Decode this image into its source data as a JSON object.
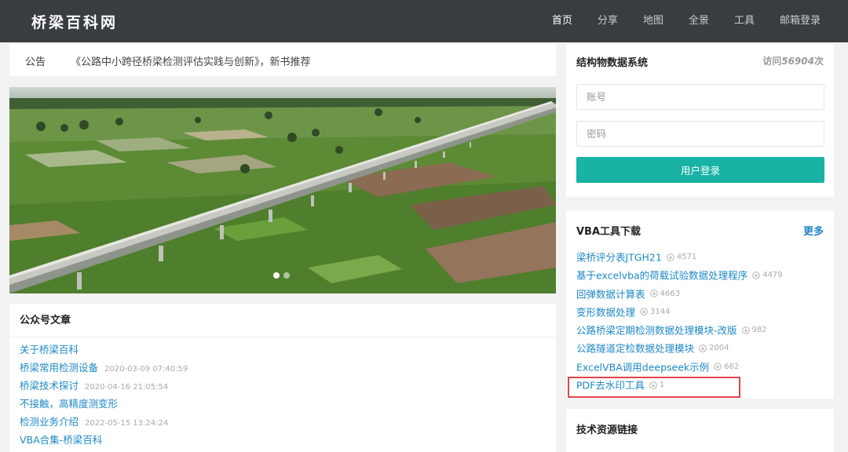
{
  "header": {
    "logo": "桥梁百科网",
    "nav": [
      "首页",
      "分享",
      "地图",
      "全景",
      "工具",
      "邮箱登录"
    ]
  },
  "notice": {
    "label": "公告",
    "text": "《公路中小跨径桥梁检测评估实践与创新》，新书推荐"
  },
  "articles": {
    "title": "公众号文章",
    "items": [
      {
        "title": "关于桥梁百科",
        "date": ""
      },
      {
        "title": "桥梁常用检测设备",
        "date": "2020-03-09 07:40:59"
      },
      {
        "title": "桥梁技术探讨",
        "date": "2020-04-16 21:05:54"
      },
      {
        "title": "不接触，高精度测变形",
        "date": ""
      },
      {
        "title": "检测业务介绍",
        "date": "2022-05-15 13:24:24"
      },
      {
        "title": "VBA合集-桥梁百科",
        "date": ""
      }
    ]
  },
  "login": {
    "title": "结构物数据系统",
    "visits_prefix": "访问",
    "visits_count": "56904",
    "visits_suffix": "次",
    "account_placeholder": "账号",
    "password_placeholder": "密码",
    "button": "用户登录"
  },
  "vba": {
    "title": "VBA工具下载",
    "more": "更多",
    "items": [
      {
        "name": "梁桥评分表JTGH21",
        "downloads": "4571"
      },
      {
        "name": "基于excelvba的荷载试验数据处理程序",
        "downloads": "4479"
      },
      {
        "name": "回弹数据计算表",
        "downloads": "4663"
      },
      {
        "name": "变形数据处理",
        "downloads": "3144"
      },
      {
        "name": "公路桥梁定期检测数据处理模块-改版",
        "downloads": "982"
      },
      {
        "name": "公路隧道定检数据处理模块",
        "downloads": "2004"
      },
      {
        "name": "ExcelVBA调用deepseek示例",
        "downloads": "662"
      },
      {
        "name": "PDF去水印工具",
        "downloads": "1"
      }
    ]
  },
  "tech": {
    "title": "技术资源链接"
  },
  "colors": {
    "header_bg": "#383d42",
    "link": "#1e88c7",
    "button": "#18b3a5",
    "highlight": "#e0454b"
  }
}
